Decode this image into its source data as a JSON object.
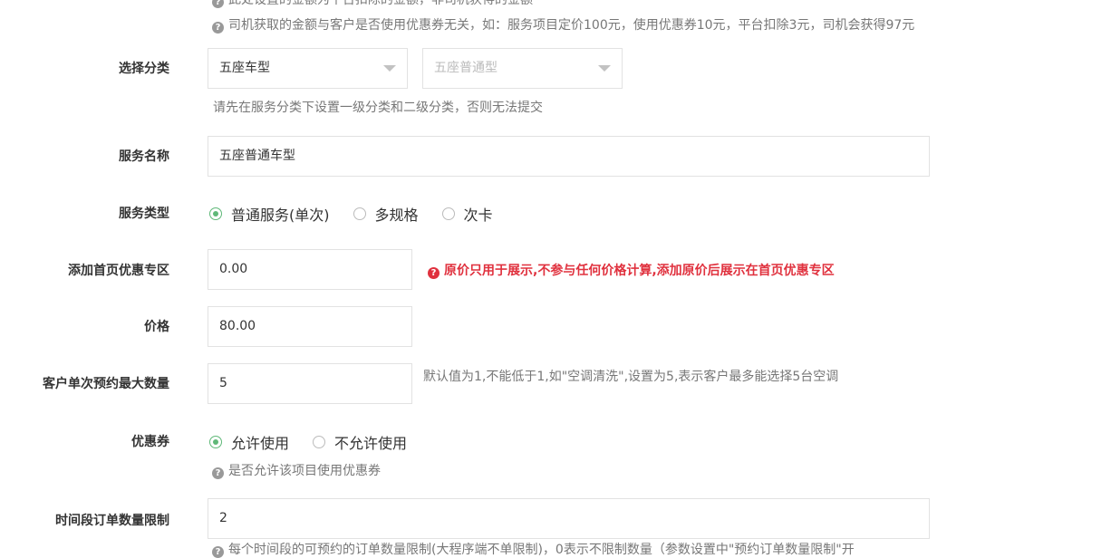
{
  "top_notes": {
    "line1": "此处设置的金额为平台扣除的金额，非司机获得的金额",
    "line2": "司机获取的金额与客户是否使用优惠券无关，如：服务项目定价100元，使用优惠券10元，平台扣除3元，司机会获得97元"
  },
  "category": {
    "label": "选择分类",
    "primary_value": "五座车型",
    "secondary_value": "五座普通型",
    "help": "请先在服务分类下设置一级分类和二级分类，否则无法提交"
  },
  "service_name": {
    "label": "服务名称",
    "value": "五座普通车型"
  },
  "service_type": {
    "label": "服务类型",
    "options": [
      "普通服务(单次)",
      "多规格",
      "次卡"
    ],
    "selected": "普通服务(单次)"
  },
  "original_price": {
    "label": "添加首页优惠专区",
    "value": "0.00",
    "warning": "原价只用于展示,不参与任何价格计算,添加原价后展示在首页优惠专区"
  },
  "price": {
    "label": "价格",
    "value": "80.00"
  },
  "max_quantity": {
    "label": "客户单次预约最大数量",
    "value": "5",
    "help": "默认值为1,不能低于1,如\"空调清洗\",设置为5,表示客户最多能选择5台空调"
  },
  "coupon": {
    "label": "优惠券",
    "options": [
      "允许使用",
      "不允许使用"
    ],
    "selected": "允许使用",
    "help": "是否允许该项目使用优惠券"
  },
  "time_slot_limit": {
    "label": "时间段订单数量限制",
    "value": "2",
    "help": "每个时间段的可预约的订单数量限制(大程序端不单限制)，0表示不限制数量（参数设置中\"预约订单数量限制\"开"
  },
  "colors": {
    "accent_green": "#5fb878",
    "warning_red": "#e0313e"
  }
}
